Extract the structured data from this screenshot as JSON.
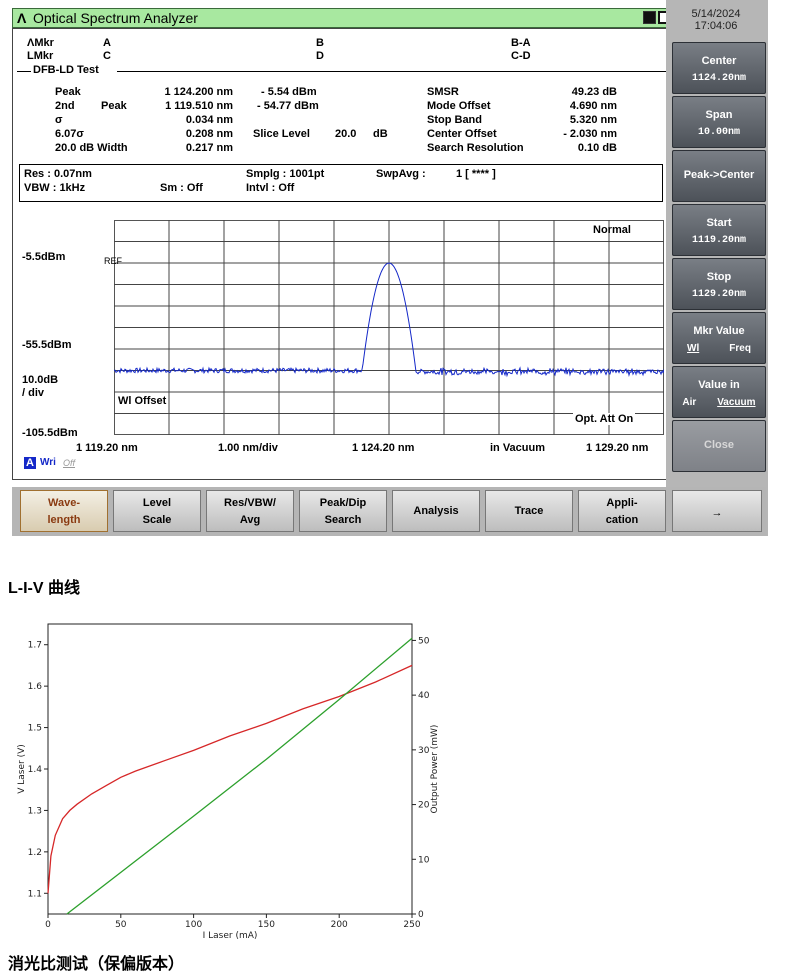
{
  "window": {
    "logo": "Λ",
    "title": "Optical Spectrum Analyzer"
  },
  "datetime": {
    "date": "5/14/2024",
    "time": "17:04:06"
  },
  "markers": {
    "row1": [
      "ΛMkr",
      "A",
      "B",
      "B-A"
    ],
    "row2": [
      "LMkr",
      "C",
      "D",
      "C-D"
    ]
  },
  "test": {
    "section": "DFB-LD Test",
    "peak_label": "Peak",
    "peak_wl": "1 124.200 nm",
    "peak_dbm": "- 5.54 dBm",
    "second_label": "2nd",
    "second_label2": "Peak",
    "second_wl": "1 119.510 nm",
    "second_dbm": "- 54.77 dBm",
    "sigma_label": "σ",
    "sigma_val": "0.034 nm",
    "sigma6_label": "6.07σ",
    "sigma6_val": "0.208 nm",
    "slice_label": "Slice Level",
    "slice_val": "20.0",
    "slice_unit": "dB",
    "width_label": "20.0 dB Width",
    "width_val": "0.217 nm",
    "smsr_label": "SMSR",
    "smsr_val": "49.23 dB",
    "mode_offset_label": "Mode Offset",
    "mode_offset_val": "4.690 nm",
    "stop_band_label": "Stop Band",
    "stop_band_val": "5.320 nm",
    "center_offset_label": "Center Offset",
    "center_offset_val": "- 2.030 nm",
    "search_res_label": "Search Resolution",
    "search_res_val": "0.10 dB"
  },
  "settings": {
    "res": "Res : 0.07nm",
    "vbw": "VBW :   1kHz",
    "smplg": "Smplg :   1001pt",
    "sm": "Sm :   Off",
    "intvl": "Intvl :   Off",
    "swpavg": "SwpAvg :",
    "swpavg_val": "1 [   **** ]"
  },
  "trace": {
    "mode": "Normal",
    "ref": "REF",
    "wl_offset": "Wl Offset",
    "opt_att": "Opt. Att On",
    "y_top": "-5.5dBm",
    "y_mid": "-55.5dBm",
    "y_bottom": "-105.5dBm",
    "scale": "10.0dB",
    "scale2": "/ div",
    "x_start": "1 119.20 nm",
    "x_div": "1.00 nm/div",
    "x_center": "1 124.20 nm",
    "x_medium": "in Vacuum",
    "x_stop": "1 129.20 nm",
    "trace_letter": "A",
    "trace_mode": "Wri",
    "trace_state": "Off",
    "color": "#1428c8"
  },
  "softkeys": [
    {
      "l1": "Center",
      "l2": "1124.20nm"
    },
    {
      "l1": "Span",
      "l2": "10.00nm"
    },
    {
      "l1": "Peak->Center",
      "l2": ""
    },
    {
      "l1": "Start",
      "l2": "1119.20nm"
    },
    {
      "l1": "Stop",
      "l2": "1129.20nm"
    },
    {
      "l1": "Mkr Value",
      "a": "Wl",
      "b": "Freq"
    },
    {
      "l1": "Value in",
      "a": "Air",
      "b": "Vacuum"
    },
    {
      "l1": "Close",
      "l2": ""
    }
  ],
  "fkeys": [
    {
      "a": "Wave-",
      "b": "length"
    },
    {
      "a": "Level",
      "b": "Scale"
    },
    {
      "a": "Res/VBW/",
      "b": "Avg"
    },
    {
      "a": "Peak/Dip",
      "b": "Search"
    },
    {
      "c": "Analysis"
    },
    {
      "c": "Trace"
    },
    {
      "a": "Appli-",
      "b": "cation"
    },
    {
      "c": "→"
    }
  ],
  "doc": {
    "liv_heading": "L-I-V 曲线",
    "extinction_heading": "消光比测试（保偏版本）"
  },
  "chart_data": {
    "type": "line",
    "xlabel": "I Laser (mA)",
    "ylabel": "V Laser (V)",
    "y2label": "Output Power (mW)",
    "xlim": [
      0,
      250
    ],
    "ylim": [
      1.05,
      1.75
    ],
    "y2lim": [
      0,
      53
    ],
    "x_ticks": [
      0,
      50,
      100,
      150,
      200,
      250
    ],
    "y_ticks": [
      1.1,
      1.2,
      1.3,
      1.4,
      1.5,
      1.6,
      1.7
    ],
    "y2_ticks": [
      0,
      10,
      20,
      30,
      40,
      50
    ],
    "series": [
      {
        "color": "#d62728",
        "axis": "left",
        "x": [
          0,
          2,
          5,
          10,
          15,
          20,
          30,
          40,
          50,
          60,
          80,
          100,
          125,
          150,
          175,
          200,
          225,
          250
        ],
        "values": [
          1.1,
          1.19,
          1.24,
          1.28,
          1.3,
          1.315,
          1.34,
          1.36,
          1.38,
          1.395,
          1.42,
          1.445,
          1.48,
          1.51,
          1.545,
          1.575,
          1.61,
          1.65
        ]
      },
      {
        "color": "#2ca02c",
        "axis": "right",
        "x": [
          13,
          50,
          100,
          150,
          200,
          250
        ],
        "values": [
          0,
          7.6,
          17.9,
          28.3,
          39.2,
          50.4
        ]
      }
    ]
  }
}
